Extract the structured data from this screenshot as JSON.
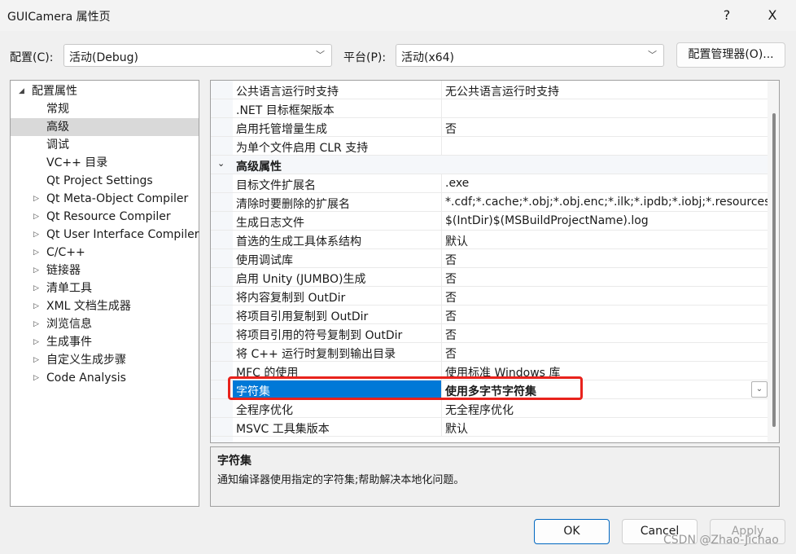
{
  "window": {
    "title": "GUICamera 属性页",
    "help": "?",
    "close": "X"
  },
  "toolbar": {
    "config_label": "配置(C):",
    "config_value": "活动(Debug)",
    "platform_label": "平台(P):",
    "platform_value": "活动(x64)",
    "manager_button": "配置管理器(O)..."
  },
  "tree": {
    "items": [
      {
        "label": "配置属性",
        "expander": "◢"
      },
      {
        "label": "常规"
      },
      {
        "label": "高级",
        "selected": true
      },
      {
        "label": "调试"
      },
      {
        "label": "VC++ 目录"
      },
      {
        "label": "Qt Project Settings"
      },
      {
        "label": "Qt Meta-Object Compiler",
        "expander": "▷"
      },
      {
        "label": "Qt Resource Compiler",
        "expander": "▷"
      },
      {
        "label": "Qt User Interface Compiler",
        "expander": "▷"
      },
      {
        "label": "C/C++",
        "expander": "▷"
      },
      {
        "label": "链接器",
        "expander": "▷"
      },
      {
        "label": "清单工具",
        "expander": "▷"
      },
      {
        "label": "XML 文档生成器",
        "expander": "▷"
      },
      {
        "label": "浏览信息",
        "expander": "▷"
      },
      {
        "label": "生成事件",
        "expander": "▷"
      },
      {
        "label": "自定义生成步骤",
        "expander": "▷"
      },
      {
        "label": "Code Analysis",
        "expander": "▷"
      }
    ]
  },
  "grid": {
    "rows": [
      {
        "name": "公共语言运行时支持",
        "value": "无公共语言运行时支持"
      },
      {
        "name": ".NET 目标框架版本",
        "value": ""
      },
      {
        "name": "启用托管增量生成",
        "value": "否"
      },
      {
        "name": "为单个文件启用 CLR 支持",
        "value": ""
      },
      {
        "name": "高级属性",
        "category": true,
        "expander": "⌄"
      },
      {
        "name": "目标文件扩展名",
        "value": ".exe"
      },
      {
        "name": "清除时要删除的扩展名",
        "value": "*.cdf;*.cache;*.obj;*.obj.enc;*.ilk;*.ipdb;*.iobj;*.resources;*.tlb;*.tli;*.t"
      },
      {
        "name": "生成日志文件",
        "value": "$(IntDir)$(MSBuildProjectName).log"
      },
      {
        "name": "首选的生成工具体系结构",
        "value": "默认"
      },
      {
        "name": "使用调试库",
        "value": "否"
      },
      {
        "name": "启用 Unity (JUMBO)生成",
        "value": "否"
      },
      {
        "name": "将内容复制到 OutDir",
        "value": "否"
      },
      {
        "name": "将项目引用复制到 OutDir",
        "value": "否"
      },
      {
        "name": "将项目引用的符号复制到 OutDir",
        "value": "否"
      },
      {
        "name": "将 C++ 运行时复制到输出目录",
        "value": "否"
      },
      {
        "name": "MFC 的使用",
        "value": "使用标准 Windows 库"
      },
      {
        "name": "字符集",
        "value": "使用多字节字符集",
        "selected": true,
        "dropdown": "⌄"
      },
      {
        "name": "全程序优化",
        "value": "无全程序优化"
      },
      {
        "name": "MSVC 工具集版本",
        "value": "默认"
      }
    ]
  },
  "description": {
    "title": "字符集",
    "text": "通知编译器使用指定的字符集;帮助解决本地化问题。"
  },
  "buttons": {
    "ok": "OK",
    "cancel": "Cancel",
    "apply": "Apply"
  },
  "watermark": "CSDN @Zhao-Jichao",
  "colors": {
    "selection": "#0078d7",
    "highlight_box": "#e8221c"
  }
}
